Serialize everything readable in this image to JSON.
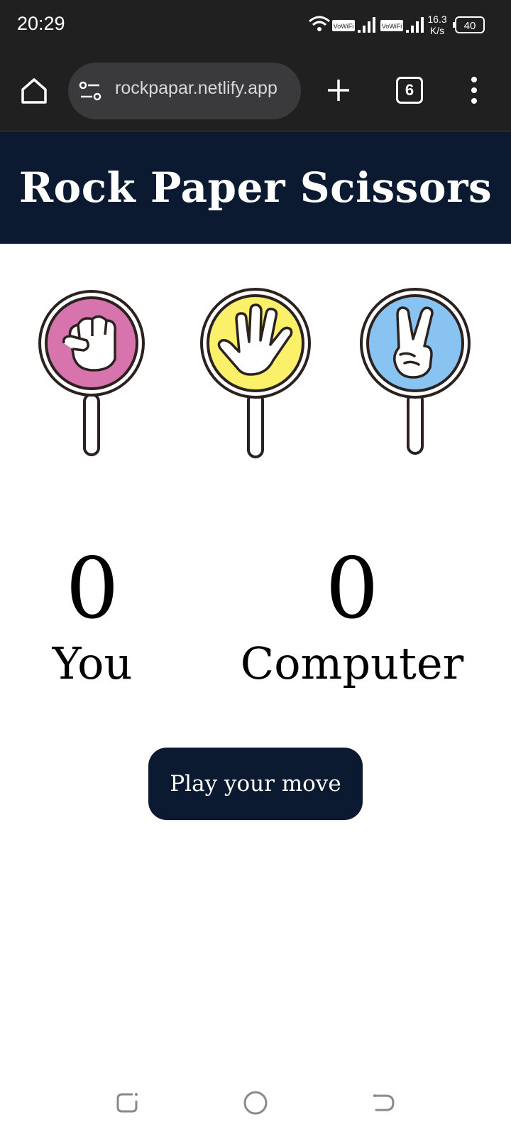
{
  "status_bar": {
    "time": "20:29",
    "network_speed_top": "16.3",
    "network_speed_bottom": "K/s",
    "battery_level": "40",
    "wifi_calling_label_1": "VoWiFi",
    "wifi_calling_label_2": "VoWiFi",
    "icons": [
      "wifi-icon",
      "signal-icon",
      "signal-icon",
      "battery-icon"
    ]
  },
  "browser": {
    "url": "rockpapar.netlify.app",
    "tab_count": "6",
    "icons": [
      "home-icon",
      "site-settings-icon",
      "plus-icon",
      "tabs-icon",
      "more-vert-icon"
    ]
  },
  "app": {
    "title": "Rock Paper Scissors",
    "choices": [
      {
        "name": "rock",
        "icon": "fist-sign-icon",
        "color": "#d774ae"
      },
      {
        "name": "paper",
        "icon": "open-hand-sign-icon",
        "color": "#fbf06a"
      },
      {
        "name": "scissors",
        "icon": "v-hand-sign-icon",
        "color": "#89c3f2"
      }
    ],
    "player": {
      "score": "0",
      "label": "You"
    },
    "computer": {
      "score": "0",
      "label": "Computer"
    },
    "play_button_label": "Play your move",
    "colors": {
      "header": "#0b1a31",
      "button": "#0b1a31",
      "background": "#ffffff"
    }
  },
  "nav_bar": {
    "icons": [
      "recent-apps-icon",
      "home-circle-icon",
      "back-icon"
    ]
  }
}
